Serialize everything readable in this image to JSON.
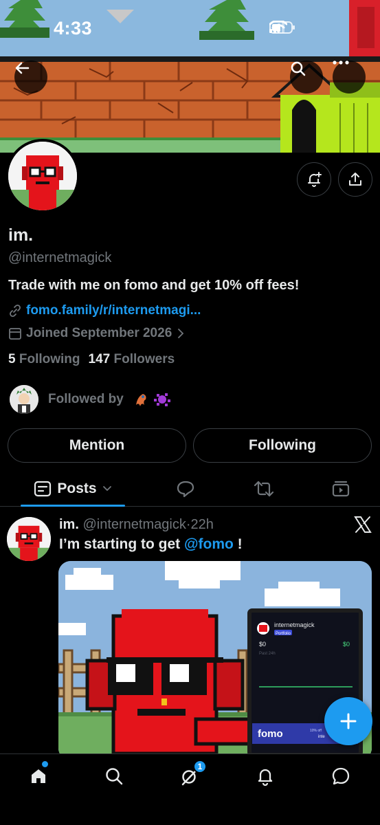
{
  "status_bar": {
    "time": "4:33"
  },
  "profile": {
    "display_name": "im.",
    "handle": "@internetmagick",
    "bio": "Trade with me on fomo and get 10% off fees!",
    "link": "fomo.family/r/internetmagi...",
    "joined": "Joined September 2026",
    "following_count": "5",
    "following_label": "Following",
    "followers_count": "147",
    "followers_label": "Followers",
    "followed_by_label": "Followed by",
    "mention_button": "Mention",
    "following_button": "Following"
  },
  "tabs": [
    {
      "label": "Posts",
      "icon": "posts-icon",
      "active": true
    },
    {
      "icon": "replies-bubble-icon"
    },
    {
      "icon": "repost-icon"
    },
    {
      "icon": "media-icon"
    }
  ],
  "post": {
    "name": "im.",
    "handle": "@internetmagick",
    "separator": "·",
    "time": "22h",
    "text_before": "I’m starting to get ",
    "mention": "@fomo",
    "text_after": " !",
    "card": {
      "username": "internetmagick",
      "tag": "Portfolio",
      "balance": "$0",
      "change": "$0",
      "period": "Past 24h",
      "brand": "fomo",
      "promo": "10% off",
      "promo_sub": "inte"
    }
  },
  "bottom_nav": {
    "items": [
      "home-icon",
      "search-icon",
      "grok-icon",
      "notifications-icon",
      "messages-icon"
    ],
    "grok_badge": "1"
  },
  "colors": {
    "accent": "#1d9bf0",
    "text": "#e7e9ea",
    "secondary": "#71767b",
    "border": "#2f3336",
    "avatar_red": "#e4141b"
  }
}
